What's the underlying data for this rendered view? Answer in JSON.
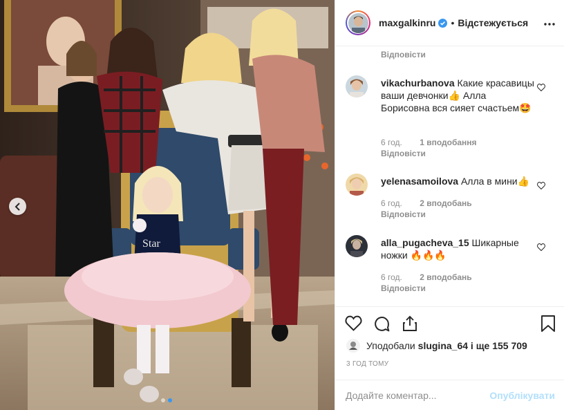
{
  "post": {
    "username": "maxgalkinru",
    "follow_state": "Відстежується",
    "separator": "•"
  },
  "icons": {
    "verified": "verified-badge-icon",
    "more": "more-options-icon",
    "prev": "chevron-left-icon",
    "like": "heart-icon",
    "comment": "comment-icon",
    "share": "share-icon",
    "save": "bookmark-icon"
  },
  "carousel": {
    "slides": 2,
    "active_index": 1
  },
  "comments": {
    "top_reply": "Відповісти",
    "items": [
      {
        "user": "vikachurbanova",
        "text": "Какие красавицы ваши девчонки👍 Алла Борисовна вся сияет счастьем🤩",
        "time": "6 год.",
        "likes": "1 вподобання",
        "reply": "Відповісти"
      },
      {
        "user": "yelenasamoilova",
        "text": "Алла в мини👍",
        "time": "6 год.",
        "likes": "2 вподобань",
        "reply": "Відповісти"
      },
      {
        "user": "alla_pugacheva_15",
        "text": "Шикарные ножки 🔥🔥🔥",
        "time": "6 год.",
        "likes": "2 вподобань",
        "reply": "Відповісти"
      }
    ]
  },
  "likes": {
    "prefix": "Уподобали",
    "user": "slugina_64",
    "suffix": "і ще 155 709"
  },
  "timestamp": "3 ГОД ТОМУ",
  "add_comment": {
    "placeholder": "Додайте коментар...",
    "publish": "Опублікувати"
  },
  "colors": {
    "accent": "#3897f0",
    "publish_disabled": "#b2dffc",
    "muted": "#8e8e8e",
    "border": "#efefef"
  }
}
